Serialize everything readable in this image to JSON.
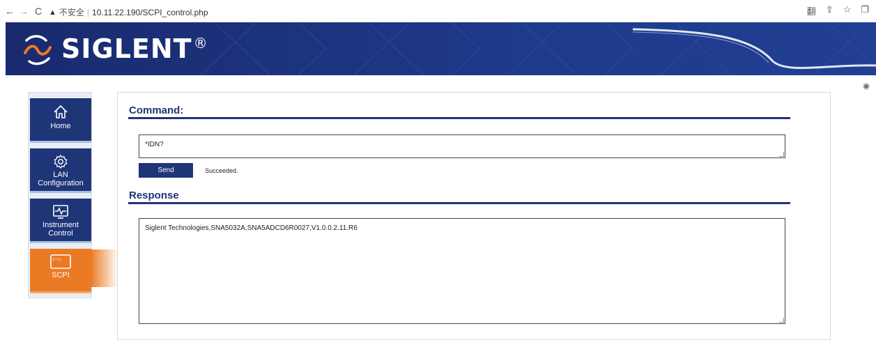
{
  "browser": {
    "back": "←",
    "forward": "→",
    "reload": "C",
    "warning": "▲",
    "insecure_label": "不安全",
    "separator": "|",
    "url": "10.11.22.190/SCPI_control.php",
    "right_icons": [
      "翻",
      "⇪",
      "☆",
      "❐"
    ]
  },
  "header": {
    "brand": "SIGLENT",
    "registered": "®"
  },
  "sidebar": {
    "items": [
      {
        "label": "Home",
        "icon": "home-icon"
      },
      {
        "label": "LAN Configuration",
        "icon": "gear-icon"
      },
      {
        "label": "Instrument Control",
        "icon": "monitor-waveform-icon"
      },
      {
        "label": "SCPI",
        "icon": "terminal-window-icon",
        "icon_text": "C:\\>"
      }
    ],
    "active_index": 3
  },
  "command": {
    "title": "Command:",
    "value": "*IDN?",
    "send_label": "Send",
    "status": "Succeeded."
  },
  "response": {
    "title": "Response",
    "value": "Siglent Technologies,SNA5032A,SNA5ADCD6R0027,V1.0.0.2.11.R6"
  },
  "colors": {
    "navy": "#1e3578",
    "orange": "#ea7a24",
    "banner": "#1a2a6e"
  }
}
